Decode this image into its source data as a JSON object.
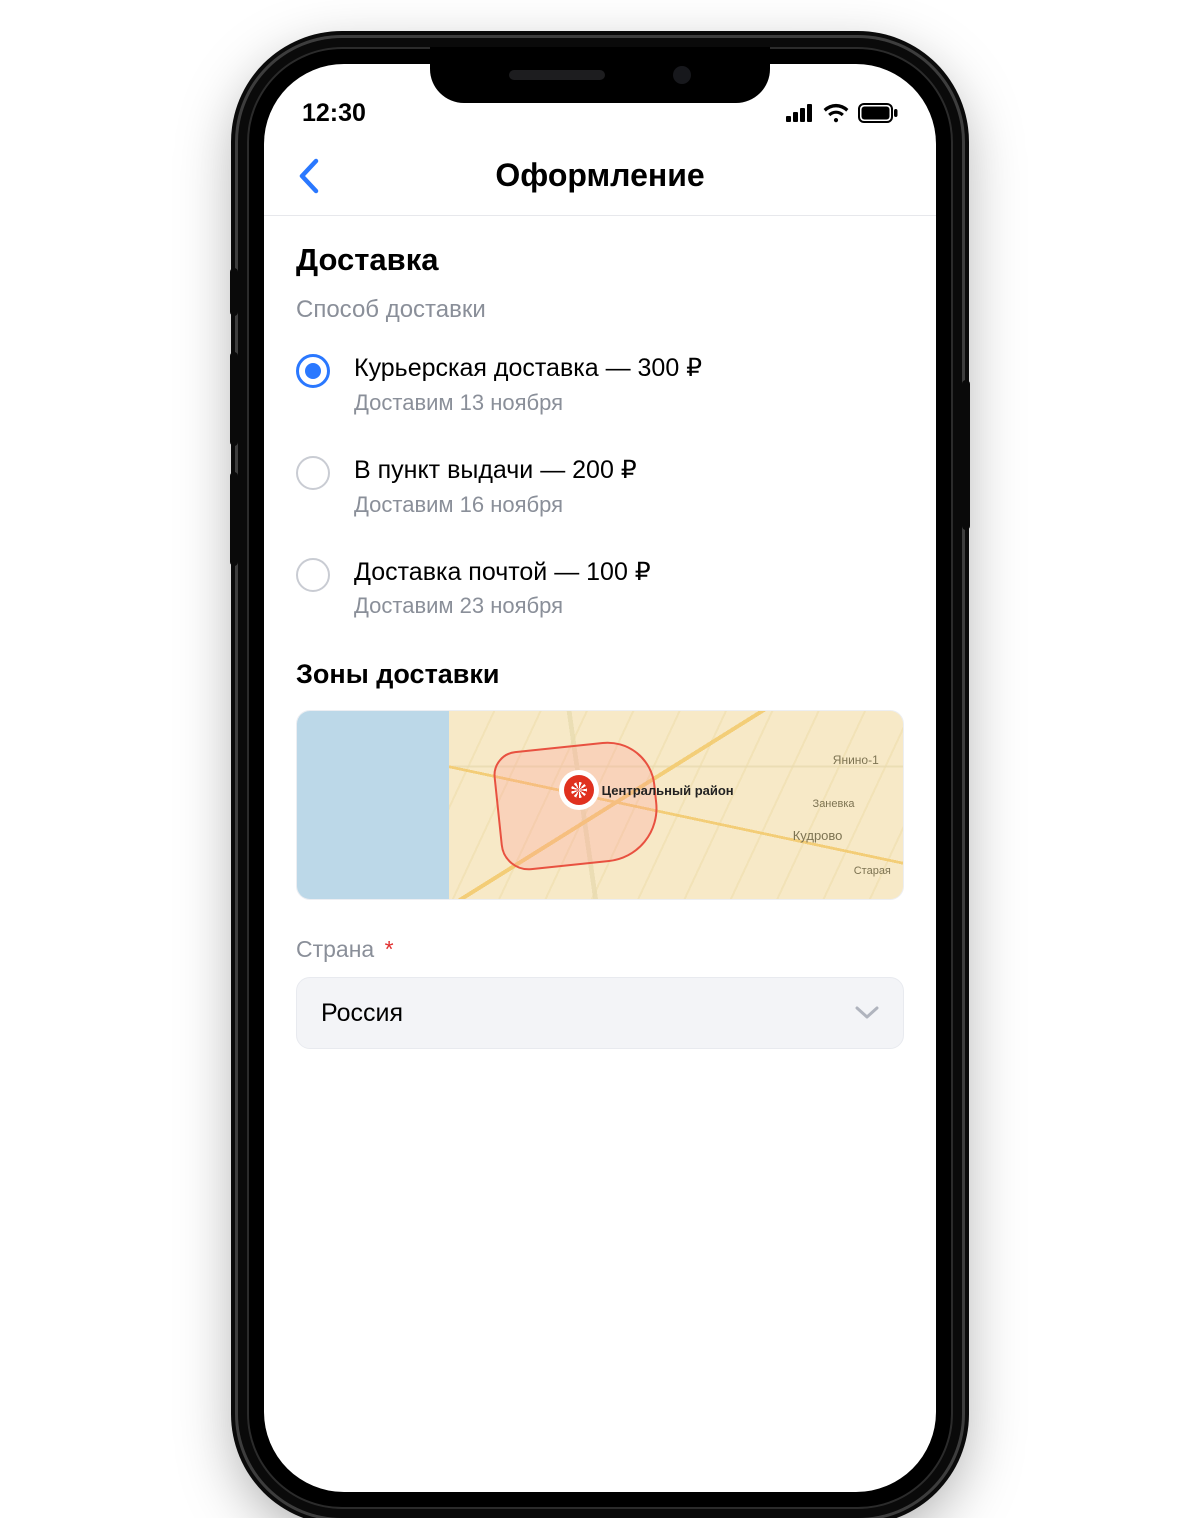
{
  "status": {
    "time": "12:30"
  },
  "nav": {
    "title": "Оформление"
  },
  "delivery": {
    "heading": "Доставка",
    "method_label": "Способ доставки",
    "options": [
      {
        "title": "Курьерская доставка — 300 ₽",
        "sub": "Доставим 13 ноября",
        "checked": true
      },
      {
        "title": "В пункт выдачи — 200 ₽",
        "sub": "Доставим 16 ноября",
        "checked": false
      },
      {
        "title": "Доставка почтой — 100 ₽",
        "sub": "Доставим 23 ноября",
        "checked": false
      }
    ]
  },
  "zones": {
    "heading": "Зоны доставки",
    "pin_label": "Центральный район",
    "places": {
      "p1": "Кудрово",
      "p2": "Янино-1",
      "p3": "Заневка",
      "p4": "Старая"
    }
  },
  "country": {
    "label": "Страна",
    "required_mark": "*",
    "value": "Россия"
  },
  "colors": {
    "accent": "#2a78ff",
    "danger": "#e03030"
  }
}
